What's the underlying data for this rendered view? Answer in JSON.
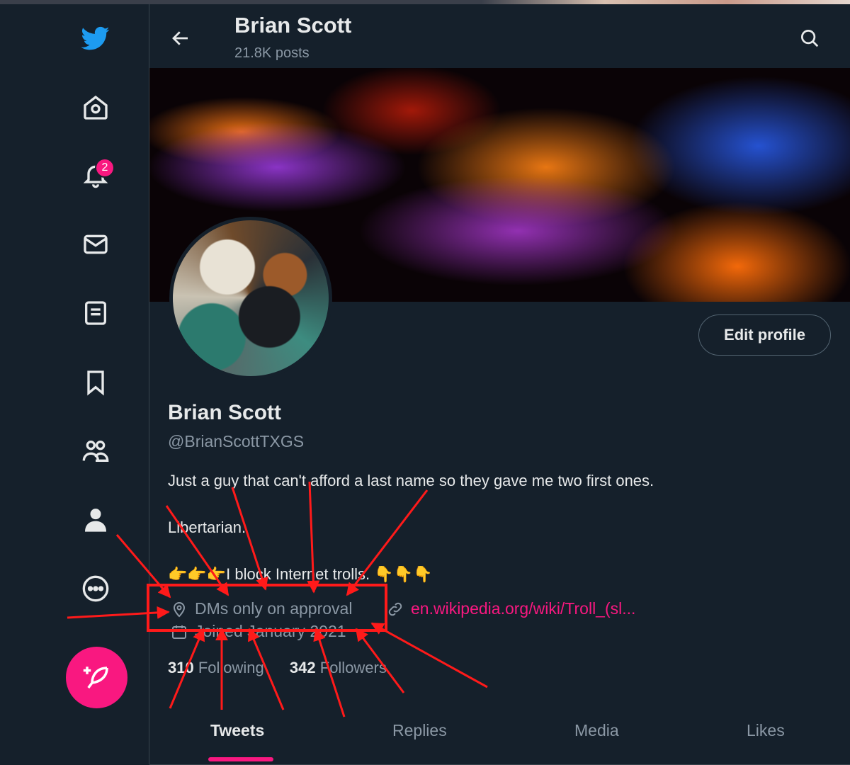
{
  "header": {
    "name": "Brian Scott",
    "posts": "21.8K posts"
  },
  "nav": {
    "notification_count": "2",
    "items": [
      "twitter-logo-icon",
      "home-icon",
      "bell-icon",
      "mail-icon",
      "list-icon",
      "bookmark-icon",
      "communities-icon",
      "profile-icon",
      "more-icon",
      "compose-icon"
    ]
  },
  "profile": {
    "edit_label": "Edit profile",
    "name": "Brian Scott",
    "handle": "@BrianScottTXGS",
    "bio_line1": "Just a guy that can't afford a last name so they gave me two first ones.",
    "bio_line2": "Libertarian.",
    "bio_line3": "👉👉👉I block Internet trolls. 👇👇👇",
    "location": "DMs only on approval",
    "website": "en.wikipedia.org/wiki/Troll_(sl...",
    "joined": "Joined January 2021",
    "following_count": "310",
    "following_label": "Following",
    "followers_count": "342",
    "followers_label": "Followers"
  },
  "tabs": [
    "Tweets",
    "Replies",
    "Media",
    "Likes"
  ],
  "colors": {
    "background": "#15202b",
    "accent": "#f91880",
    "annotation": "#ff1a1a"
  }
}
